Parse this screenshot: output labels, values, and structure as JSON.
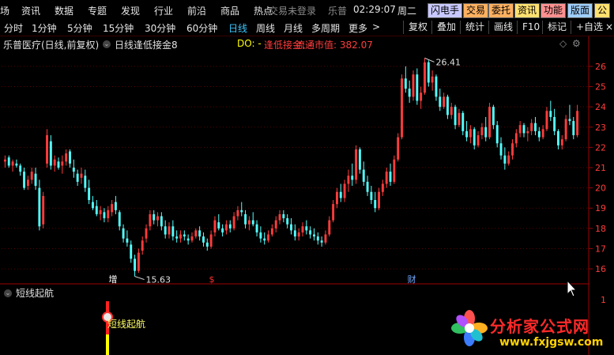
{
  "menu": {
    "items": [
      "场",
      "资讯",
      "数据",
      "专题",
      "发现",
      "行业",
      "前沿",
      "商品",
      "热点"
    ],
    "login_status": "交易未登录",
    "brand": "乐普",
    "time": "02:29:07",
    "weekday": "周二",
    "function_buttons": [
      {
        "label": "闪电手",
        "color": "#c8c8ff"
      },
      {
        "label": "交易",
        "color": "#ffb060"
      },
      {
        "label": "委托",
        "color": "#ffb060"
      },
      {
        "label": "资讯",
        "color": "#ffe070"
      },
      {
        "label": "功能",
        "color": "#ff9090"
      },
      {
        "label": "版面",
        "color": "#a0d0ff"
      },
      {
        "label": "公",
        "color": "#ffe070"
      }
    ]
  },
  "periods": {
    "tabs": [
      "分时",
      "1分钟",
      "5分钟",
      "15分钟",
      "30分钟",
      "60分钟",
      "日线",
      "周线",
      "月线",
      "多周期",
      "更多"
    ],
    "active": "日线",
    "more_arrow": ">",
    "right_buttons": [
      "复权",
      "叠加",
      "统计",
      "画线",
      "F10",
      "标记",
      "+自选"
    ],
    "close_button": "×"
  },
  "info": {
    "stock": "乐普医疗(日线,前复权)",
    "formula": "日线逢低接金8",
    "do_label": "DO: -",
    "signal_label": "逢低接金: -",
    "float_cap_label": "流通市值: 382.07"
  },
  "chart_data": {
    "type": "candlestick",
    "y_axis_ticks": [
      26,
      25,
      24,
      23,
      22,
      21,
      20,
      19,
      18,
      17,
      16
    ],
    "ylim": [
      15.3,
      26.7
    ],
    "colors": {
      "up": "#ff3c3c",
      "down": "#54ffff"
    },
    "high_annotation": "26.41",
    "low_annotation": "15.63",
    "high_label_value": 26.41,
    "low_label_value": 15.63,
    "markers": [
      {
        "text": "增",
        "color": "#ffffff"
      },
      {
        "text": "$",
        "color": "#ff3030"
      },
      {
        "text": "财",
        "color": "#6fa8ff"
      }
    ],
    "candles": [
      [
        21.3,
        21.6,
        21.0,
        21.4
      ],
      [
        21.5,
        21.6,
        21.0,
        21.1
      ],
      [
        21.1,
        21.4,
        20.8,
        21.3
      ],
      [
        21.2,
        21.4,
        21.0,
        21.1
      ],
      [
        21.1,
        21.2,
        20.6,
        20.8
      ],
      [
        20.8,
        21.0,
        19.9,
        20.0
      ],
      [
        20.1,
        20.6,
        19.9,
        20.4
      ],
      [
        20.4,
        21.0,
        20.2,
        20.8
      ],
      [
        20.7,
        21.0,
        19.9,
        20.1
      ],
      [
        20.0,
        20.4,
        17.9,
        18.1
      ],
      [
        18.2,
        19.8,
        18.0,
        19.6
      ],
      [
        21.2,
        22.9,
        21.0,
        22.6
      ],
      [
        22.3,
        22.6,
        20.9,
        21.1
      ],
      [
        21.1,
        21.6,
        20.8,
        21.4
      ],
      [
        21.3,
        21.5,
        20.9,
        21.0
      ],
      [
        21.1,
        21.6,
        20.7,
        21.3
      ],
      [
        21.3,
        21.9,
        21.1,
        21.7
      ],
      [
        21.8,
        21.9,
        21.0,
        21.2
      ],
      [
        21.0,
        21.4,
        20.5,
        20.8
      ],
      [
        20.7,
        20.9,
        20.1,
        20.3
      ],
      [
        20.5,
        21.0,
        20.2,
        20.7
      ],
      [
        20.6,
        20.9,
        19.8,
        20.0
      ],
      [
        20.0,
        20.4,
        19.2,
        19.4
      ],
      [
        19.3,
        19.6,
        18.9,
        19.0
      ],
      [
        19.1,
        19.4,
        18.6,
        18.7
      ],
      [
        18.7,
        19.1,
        18.4,
        18.9
      ],
      [
        18.8,
        19.0,
        18.3,
        18.5
      ],
      [
        18.5,
        19.1,
        18.3,
        18.9
      ],
      [
        18.8,
        19.4,
        18.6,
        19.2
      ],
      [
        19.3,
        19.6,
        18.7,
        18.9
      ],
      [
        18.8,
        18.9,
        17.9,
        18.1
      ],
      [
        18.0,
        18.2,
        17.3,
        17.5
      ],
      [
        17.5,
        17.9,
        17.1,
        17.3
      ],
      [
        17.2,
        17.4,
        16.3,
        16.5
      ],
      [
        16.5,
        16.7,
        15.63,
        15.9
      ],
      [
        15.9,
        17.0,
        15.8,
        16.8
      ],
      [
        16.9,
        17.6,
        16.7,
        17.4
      ],
      [
        17.5,
        18.2,
        17.3,
        18.0
      ],
      [
        18.1,
        18.9,
        17.9,
        18.7
      ],
      [
        18.7,
        18.9,
        18.2,
        18.4
      ],
      [
        18.4,
        18.8,
        18.1,
        18.6
      ],
      [
        18.6,
        18.8,
        17.9,
        18.1
      ],
      [
        18.1,
        18.4,
        17.5,
        17.7
      ],
      [
        17.7,
        18.3,
        17.5,
        18.1
      ],
      [
        18.1,
        18.4,
        17.4,
        17.6
      ],
      [
        17.6,
        17.9,
        17.3,
        17.5
      ],
      [
        17.5,
        17.9,
        17.3,
        17.7
      ],
      [
        17.7,
        17.9,
        17.4,
        17.6
      ],
      [
        17.5,
        17.7,
        17.2,
        17.4
      ],
      [
        17.4,
        17.8,
        17.3,
        17.6
      ],
      [
        17.6,
        18.0,
        17.5,
        17.9
      ],
      [
        17.9,
        18.1,
        17.4,
        17.6
      ],
      [
        17.6,
        17.8,
        17.1,
        17.3
      ],
      [
        17.3,
        17.5,
        16.9,
        17.1
      ],
      [
        17.1,
        17.9,
        17.0,
        17.7
      ],
      [
        17.8,
        18.6,
        17.6,
        18.4
      ],
      [
        18.3,
        18.7,
        17.9,
        18.0
      ],
      [
        18.0,
        18.2,
        17.6,
        17.8
      ],
      [
        17.9,
        18.4,
        17.7,
        18.2
      ],
      [
        18.2,
        18.4,
        17.8,
        18.0
      ],
      [
        18.0,
        18.8,
        17.9,
        18.6
      ],
      [
        18.6,
        19.1,
        18.4,
        18.9
      ],
      [
        18.9,
        19.3,
        18.6,
        18.8
      ],
      [
        18.7,
        18.9,
        18.0,
        18.2
      ],
      [
        18.2,
        18.6,
        17.9,
        18.4
      ],
      [
        18.4,
        18.8,
        18.1,
        18.2
      ],
      [
        18.2,
        18.4,
        17.6,
        17.8
      ],
      [
        17.8,
        18.1,
        17.3,
        17.5
      ],
      [
        17.5,
        17.8,
        17.2,
        17.4
      ],
      [
        17.4,
        17.9,
        17.3,
        17.7
      ],
      [
        17.7,
        18.2,
        17.6,
        18.0
      ],
      [
        18.0,
        18.6,
        17.8,
        18.4
      ],
      [
        18.4,
        18.9,
        18.2,
        18.7
      ],
      [
        18.7,
        18.9,
        18.3,
        18.5
      ],
      [
        18.5,
        18.7,
        18.0,
        18.2
      ],
      [
        18.2,
        18.5,
        17.7,
        17.9
      ],
      [
        17.9,
        18.2,
        17.4,
        17.6
      ],
      [
        17.6,
        18.0,
        17.4,
        17.8
      ],
      [
        17.8,
        18.3,
        17.6,
        18.1
      ],
      [
        18.1,
        18.4,
        17.7,
        17.9
      ],
      [
        17.9,
        18.1,
        17.5,
        17.7
      ],
      [
        17.7,
        18.0,
        17.4,
        17.6
      ],
      [
        17.6,
        17.8,
        17.2,
        17.4
      ],
      [
        17.4,
        17.6,
        17.1,
        17.3
      ],
      [
        17.3,
        17.9,
        17.2,
        17.7
      ],
      [
        17.7,
        18.6,
        17.6,
        18.4
      ],
      [
        18.4,
        19.4,
        18.3,
        19.2
      ],
      [
        19.2,
        20.0,
        19.0,
        19.8
      ],
      [
        19.8,
        20.2,
        19.3,
        19.5
      ],
      [
        19.5,
        20.4,
        19.3,
        20.2
      ],
      [
        20.2,
        20.9,
        19.8,
        20.6
      ],
      [
        20.6,
        21.2,
        20.1,
        20.4
      ],
      [
        20.4,
        22.1,
        20.2,
        21.9
      ],
      [
        21.9,
        22.0,
        20.7,
        20.9
      ],
      [
        20.9,
        21.3,
        20.1,
        20.3
      ],
      [
        20.3,
        20.6,
        19.6,
        19.8
      ],
      [
        19.8,
        20.1,
        19.2,
        19.4
      ],
      [
        19.4,
        19.8,
        18.8,
        19.0
      ],
      [
        19.0,
        20.0,
        18.9,
        19.8
      ],
      [
        19.8,
        20.4,
        19.6,
        20.2
      ],
      [
        20.2,
        21.0,
        20.0,
        20.8
      ],
      [
        20.8,
        21.2,
        20.1,
        20.3
      ],
      [
        20.3,
        21.6,
        20.2,
        21.4
      ],
      [
        21.4,
        22.7,
        21.3,
        22.5
      ],
      [
        22.5,
        25.6,
        22.4,
        25.4
      ],
      [
        25.4,
        26.0,
        24.7,
        24.9
      ],
      [
        24.9,
        25.3,
        24.2,
        24.5
      ],
      [
        24.5,
        25.8,
        24.3,
        25.6
      ],
      [
        25.6,
        25.9,
        24.1,
        24.3
      ],
      [
        24.3,
        25.0,
        23.9,
        24.7
      ],
      [
        24.7,
        26.41,
        24.6,
        26.2
      ],
      [
        26.2,
        26.3,
        25.0,
        25.2
      ],
      [
        25.2,
        25.8,
        24.8,
        25.5
      ],
      [
        25.5,
        25.6,
        24.3,
        24.5
      ],
      [
        24.5,
        24.9,
        23.8,
        24.0
      ],
      [
        24.0,
        24.7,
        23.9,
        24.5
      ],
      [
        24.5,
        24.6,
        23.4,
        23.6
      ],
      [
        23.6,
        24.2,
        23.4,
        24.0
      ],
      [
        24.0,
        24.1,
        22.9,
        23.1
      ],
      [
        23.1,
        23.9,
        23.0,
        23.7
      ],
      [
        23.7,
        23.8,
        22.6,
        22.8
      ],
      [
        22.8,
        23.3,
        22.3,
        22.5
      ],
      [
        22.5,
        23.1,
        22.2,
        22.9
      ],
      [
        22.9,
        23.0,
        21.9,
        22.1
      ],
      [
        22.1,
        22.8,
        22.0,
        22.6
      ],
      [
        22.6,
        23.2,
        22.4,
        23.0
      ],
      [
        23.0,
        23.5,
        22.3,
        22.5
      ],
      [
        22.5,
        24.2,
        22.4,
        24.0
      ],
      [
        24.0,
        24.1,
        22.9,
        23.1
      ],
      [
        23.1,
        23.3,
        22.0,
        22.2
      ],
      [
        22.2,
        22.5,
        21.4,
        21.6
      ],
      [
        21.6,
        22.0,
        20.9,
        21.2
      ],
      [
        21.2,
        21.8,
        21.1,
        21.6
      ],
      [
        21.6,
        22.4,
        21.4,
        22.2
      ],
      [
        22.2,
        22.9,
        22.0,
        22.7
      ],
      [
        22.7,
        23.3,
        22.5,
        23.1
      ],
      [
        23.1,
        23.2,
        22.5,
        22.7
      ],
      [
        22.7,
        23.0,
        22.3,
        22.8
      ],
      [
        22.8,
        23.4,
        22.6,
        23.2
      ],
      [
        23.2,
        23.5,
        22.6,
        22.8
      ],
      [
        22.8,
        23.0,
        22.3,
        22.5
      ],
      [
        22.5,
        23.1,
        22.4,
        22.9
      ],
      [
        22.9,
        24.0,
        22.8,
        23.8
      ],
      [
        23.8,
        24.3,
        23.3,
        23.5
      ],
      [
        23.5,
        23.9,
        22.6,
        22.8
      ],
      [
        22.8,
        22.9,
        21.9,
        22.1
      ],
      [
        22.1,
        22.6,
        21.9,
        22.4
      ],
      [
        22.4,
        23.6,
        22.3,
        23.4
      ],
      [
        23.4,
        24.1,
        23.1,
        23.3
      ],
      [
        23.3,
        23.5,
        22.4,
        22.6
      ],
      [
        22.6,
        24.1,
        22.5,
        23.8
      ]
    ]
  },
  "sub_indicator": {
    "title": "短线起航",
    "signal_label": "短线起航",
    "y_axis_tick": "1",
    "bar_colors": [
      "#ff2020",
      "#ffff00"
    ]
  },
  "watermark": {
    "name": "分析家公式网",
    "url": "www.fxjgsw.com"
  }
}
